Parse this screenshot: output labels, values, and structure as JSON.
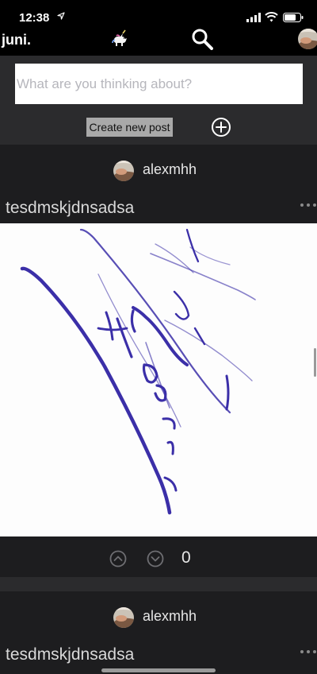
{
  "status_bar": {
    "time": "12:38",
    "icons": [
      "location-arrow-icon",
      "signal-bars-icon",
      "wifi-icon",
      "battery-icon"
    ]
  },
  "navbar": {
    "brand": "juni.",
    "icons": [
      "unicorn-icon",
      "search-icon",
      "profile-avatar"
    ]
  },
  "composer": {
    "placeholder": "What are you thinking about?",
    "value": "",
    "create_label": "Create new post",
    "add_icon": "plus-circle-icon"
  },
  "posts": [
    {
      "author": "alexmhh",
      "title": "tesdmskjdnsadsa",
      "has_image": true,
      "image_description_icon": "handwritten-signature-image",
      "votes": "0",
      "up_icon": "chevron-up-circle-icon",
      "down_icon": "chevron-down-circle-icon",
      "more_icon": "more-dots-icon"
    },
    {
      "author": "alexmhh",
      "title": "tesdmskjdnsadsa",
      "more_icon": "more-dots-icon"
    }
  ],
  "colors": {
    "background": "#1d1d1f",
    "panel": "#2b2b2d",
    "bar": "#000000",
    "ink": "#3b2fa8",
    "button": "#a9a9a9"
  }
}
